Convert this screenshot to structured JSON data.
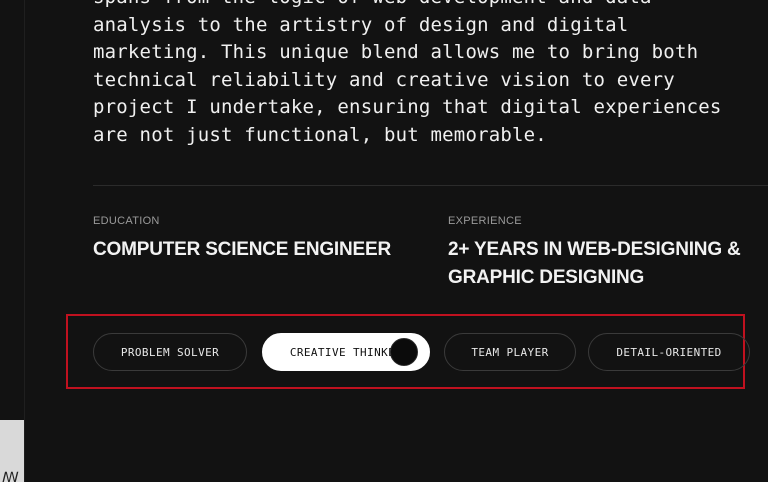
{
  "bio": {
    "lines": [
      "spans from the logic of web development and data",
      "analysis to the artistry of design and digital",
      "marketing. This unique blend allows me to bring both",
      "technical reliability and creative vision to every",
      "project I undertake, ensuring that digital experiences",
      "are not just functional, but memorable."
    ]
  },
  "education": {
    "label": "EDUCATION",
    "value": "COMPUTER SCIENCE ENGINEER"
  },
  "experience": {
    "label": "EXPERIENCE",
    "value_line1": "2+ YEARS IN WEB-DESIGNING &",
    "value_line2": "GRAPHIC DESIGNING"
  },
  "tags": [
    {
      "label": "PROBLEM SOLVER",
      "active": false
    },
    {
      "label": "CREATIVE THINKER",
      "active": true
    },
    {
      "label": "TEAM PLAYER",
      "active": false
    },
    {
      "label": "DETAIL-ORIENTED",
      "active": false
    }
  ],
  "colors": {
    "background": "#121212",
    "highlight_border": "#c0111f",
    "active_tag_bg": "#ffffff"
  }
}
